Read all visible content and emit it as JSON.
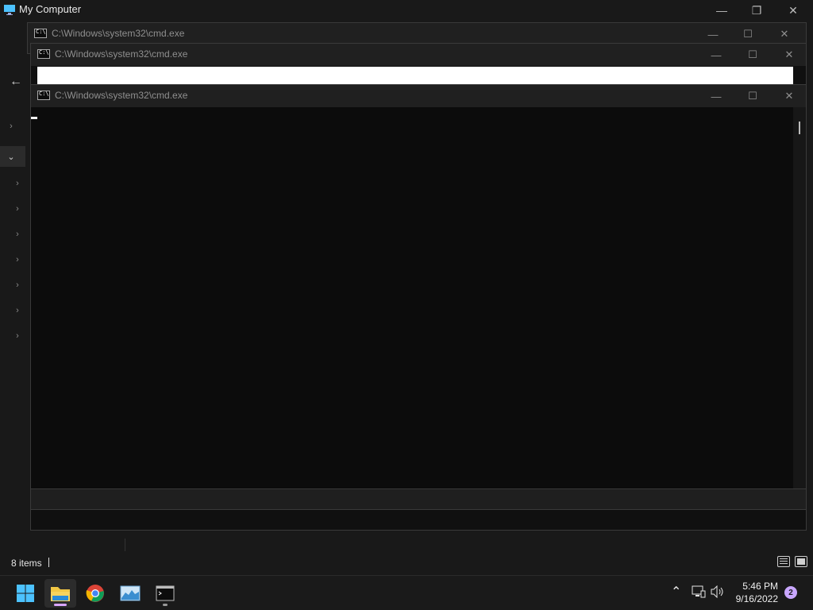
{
  "explorer": {
    "title": "My Computer",
    "status": "8 items"
  },
  "console_windows": [
    {
      "title": "C:\\Windows\\system32\\cmd.exe"
    },
    {
      "title": "C:\\Windows\\system32\\cmd.exe"
    },
    {
      "title": "C:\\Windows\\system32\\cmd.exe"
    }
  ],
  "window_controls": {
    "minimize": "—",
    "maximize": "☐",
    "restore": "❐",
    "close": "✕"
  },
  "taskbar": {
    "apps": [
      "start-icon",
      "file-explorer-icon",
      "chrome-icon",
      "resource-monitor-icon",
      "command-prompt-icon"
    ],
    "clock_time": "5:46 PM",
    "clock_date": "9/16/2022",
    "notification_count": "2"
  },
  "colors": {
    "accent": "#4cc2ff",
    "taskbar_indicator": "#d9a6ff"
  }
}
